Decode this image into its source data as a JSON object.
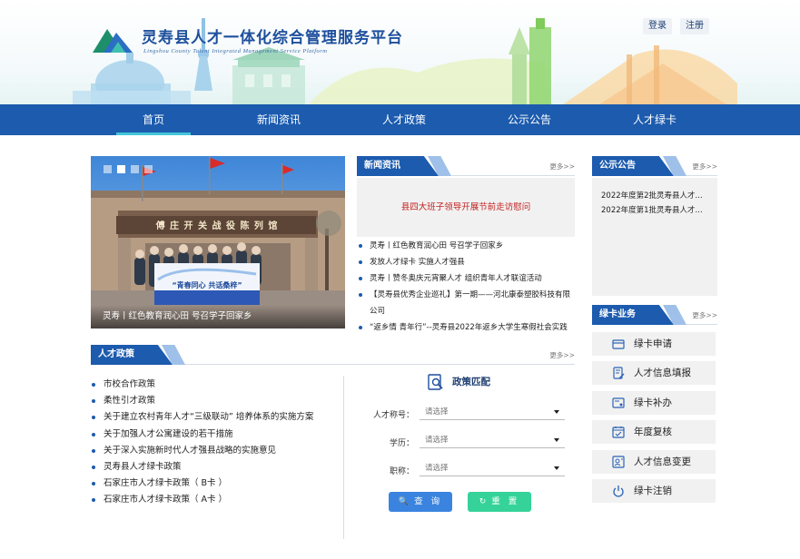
{
  "header": {
    "title": "灵寿县人才一体化综合管理服务平台",
    "subtitle": "Lingshou County Talent Integrated Management Service Platform",
    "login": "登录",
    "register": "注册"
  },
  "nav": {
    "items": [
      {
        "label": "首页",
        "active": true
      },
      {
        "label": "新闻资讯"
      },
      {
        "label": "人才政策"
      },
      {
        "label": "公示公告"
      },
      {
        "label": "人才绿卡"
      }
    ]
  },
  "slider": {
    "caption": "灵寿丨红色教育润心田 号召学子回家乡",
    "banner_text": "“青春同心 共话桑梓”",
    "gate_text": "傅 庄 开 关 战 役 陈 列 馆"
  },
  "news": {
    "title": "新闻资讯",
    "more": "更多>>",
    "featured": "县四大班子领导开展节前走访慰问",
    "items": [
      "灵寿丨红色教育润心田 号召学子回家乡",
      "发放人才绿卡 实施人才强县",
      "灵寿丨赞冬奥庆元宵聚人才 组织青年人才联谊活动",
      "【灵寿县优秀企业巡礼】第一期——河北康泰塑胶科技有限公司",
      "“返乡情 青年行”--灵寿县2022年返乡大学生寒假社会实践"
    ]
  },
  "notice": {
    "title": "公示公告",
    "more": "更多>>",
    "items": [
      "2022年度第2批灵寿县人才...",
      "2022年度第1批灵寿县人才..."
    ]
  },
  "greencard": {
    "title": "绿卡业务",
    "more": "更多>>",
    "items": [
      {
        "label": "绿卡申请",
        "icon": "card-icon"
      },
      {
        "label": "人才信息填报",
        "icon": "edit-form-icon"
      },
      {
        "label": "绿卡补办",
        "icon": "card-reissue-icon"
      },
      {
        "label": "年度复核",
        "icon": "calendar-review-icon"
      },
      {
        "label": "人才信息变更",
        "icon": "user-change-icon"
      },
      {
        "label": "绿卡注销",
        "icon": "power-icon"
      }
    ]
  },
  "policy": {
    "title": "人才政策",
    "more": "更多>>",
    "items": [
      "市校合作政策",
      "柔性引才政策",
      "关于建立农村青年人才“三级联动” 培养体系的实施方案",
      "关于加强人才公寓建设的若干措施",
      "关于深入实施新时代人才强县战略的实施意见",
      "灵寿县人才绿卡政策",
      "石家庄市人才绿卡政策（ B卡 ）",
      "石家庄市人才绿卡政策（ A卡 ）"
    ]
  },
  "match": {
    "title": "政策匹配",
    "fields": [
      {
        "label": "人才称号：",
        "placeholder": "请选择"
      },
      {
        "label": "学历：",
        "placeholder": "请选择"
      },
      {
        "label": "职称：",
        "placeholder": "请选择"
      }
    ],
    "query": "查 询",
    "reset": "重 置"
  },
  "colors": {
    "primary": "#1c5bae",
    "nav_active": "#42c6d8",
    "headline_red": "#c21f1f",
    "query_btn": "#3a84e0",
    "reset_btn": "#35d39a"
  }
}
